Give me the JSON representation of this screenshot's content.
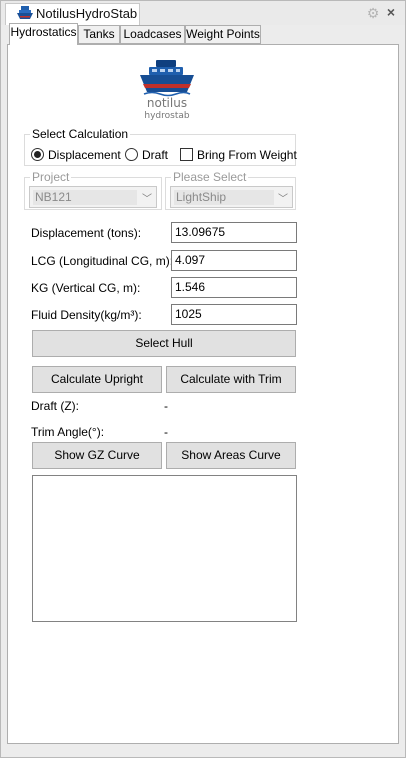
{
  "window": {
    "title": "NotilusHydroStab"
  },
  "tabs": [
    {
      "label": "Hydrostatics"
    },
    {
      "label": "Tanks"
    },
    {
      "label": "Loadcases"
    },
    {
      "label": "Weight Points"
    }
  ],
  "logo": {
    "line1": "notilus",
    "line2": "hydrostab"
  },
  "select_calculation": {
    "title": "Select Calculation",
    "options": [
      {
        "label": "Displacement",
        "checked": true
      },
      {
        "label": "Draft",
        "checked": false
      }
    ],
    "bring_from_weight": {
      "label": "Bring From Weight",
      "checked": false
    }
  },
  "project": {
    "label": "Project",
    "value": "NB121"
  },
  "please_select": {
    "label": "Please Select",
    "value": "LightShip"
  },
  "fields": {
    "displacement": {
      "label": "Displacement (tons):",
      "value": "13.09675"
    },
    "lcg": {
      "label": "LCG (Longitudinal CG, m):",
      "value": "4.097"
    },
    "kg": {
      "label": "KG (Vertical CG, m):",
      "value": "1.546"
    },
    "fluid_density": {
      "label": "Fluid Density(kg/m³):",
      "value": "1025"
    }
  },
  "buttons": {
    "select_hull": "Select Hull",
    "calculate_upright": "Calculate Upright",
    "calculate_with_trim": "Calculate with Trim",
    "show_gz_curve": "Show GZ Curve",
    "show_areas_curve": "Show Areas Curve"
  },
  "results": {
    "draft": {
      "label": "Draft (Z):",
      "value": "-"
    },
    "trim_angle": {
      "label": "Trim Angle(°):",
      "value": "-"
    }
  },
  "icons": {
    "app": "ship-icon",
    "settings": "gear-icon",
    "close": "close-icon",
    "dropdown": "chevron-down-icon"
  },
  "colors": {
    "logo_blue": "#1f5fae",
    "logo_red": "#c0302b",
    "panel_bg": "#ffffff",
    "button_bg": "#e1e1e1"
  }
}
